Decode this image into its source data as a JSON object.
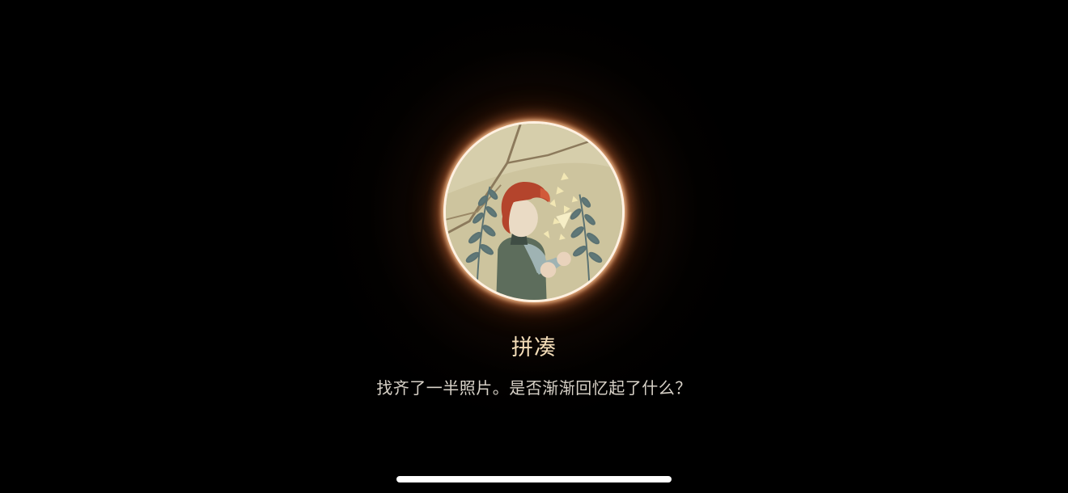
{
  "achievement": {
    "icon": "boy-holding-light-icon",
    "title": "拼凑",
    "description": "找齐了一半照片。是否渐渐回忆起了什么？"
  },
  "colors": {
    "background": "#000000",
    "badge_ring": "#fff1e2",
    "badge_glow": "#e8804a",
    "title_text": "#f4ddb8",
    "description_text": "#d8d2c8",
    "home_indicator": "#ffffff"
  }
}
